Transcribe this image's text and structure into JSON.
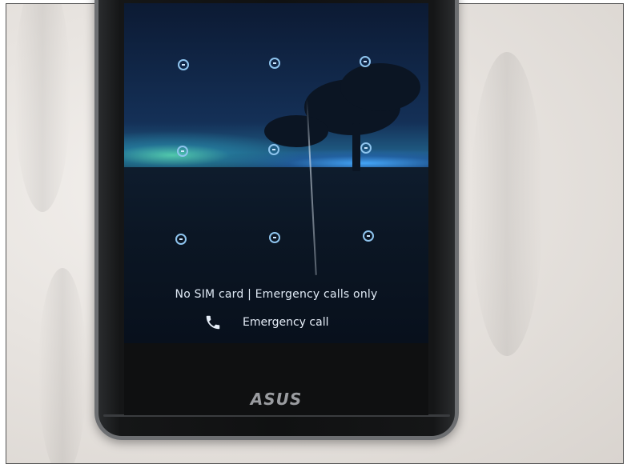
{
  "lock_screen": {
    "status": "No SIM card | Emergency calls only",
    "emergency_call_label": "Emergency call",
    "emergency_icon": "phone-icon",
    "pattern_dot_count": 9
  },
  "device": {
    "brand_logo": "ASUS"
  },
  "colors": {
    "pattern_dot": "#8ec4ee",
    "screen_text": "#dfe9f5",
    "phone_body": "#101112",
    "background": "#e8e4e0"
  }
}
